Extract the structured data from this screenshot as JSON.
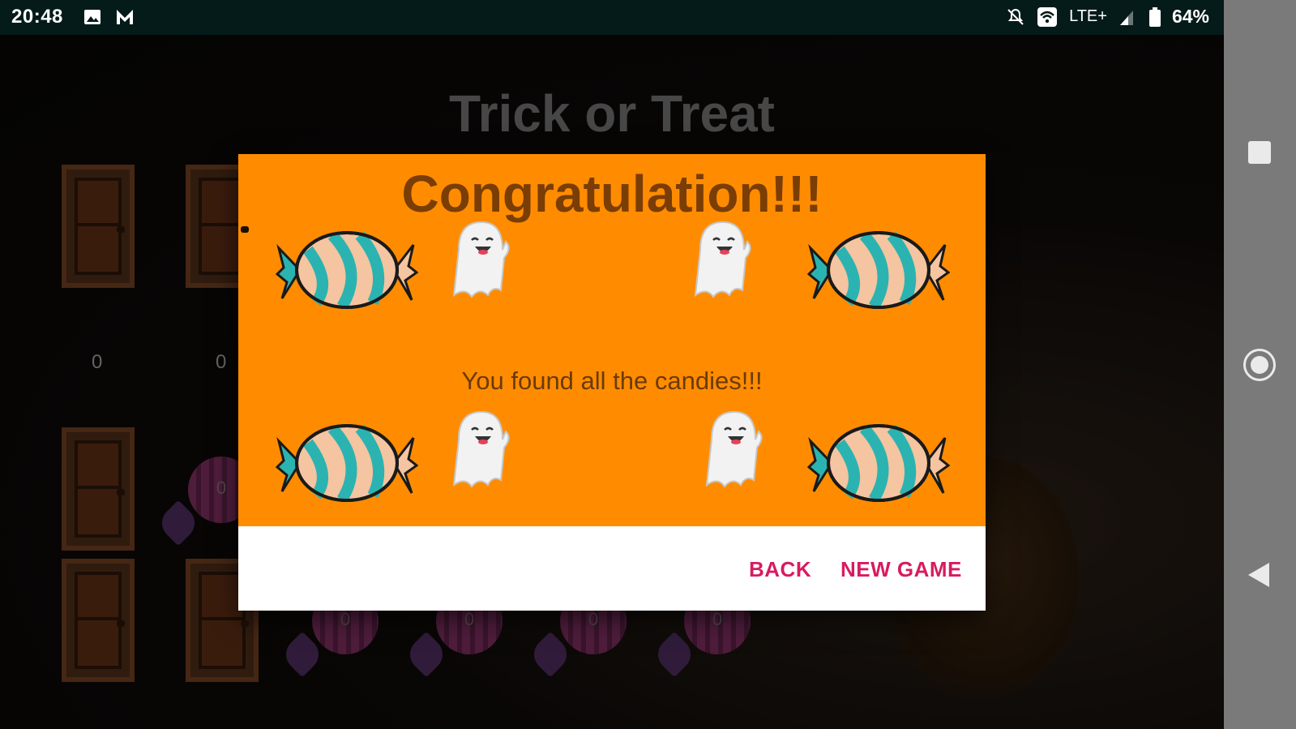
{
  "status_bar": {
    "time": "20:48",
    "left_icons": [
      "image-icon",
      "messenger-icon"
    ],
    "network": "LTE+",
    "battery": "64%",
    "right_icons": [
      "mute-icon",
      "wifi-icon",
      "signal-icon",
      "battery-icon"
    ]
  },
  "game": {
    "title": "Trick or Treat",
    "scores": [
      "0",
      "0"
    ],
    "candy_labels": [
      "0",
      "0",
      "0",
      "0",
      "0"
    ]
  },
  "dialog": {
    "title": "Congratulation!!!",
    "message": "You found all the candies!!!",
    "buttons": {
      "back": "BACK",
      "new_game": "NEW GAME"
    },
    "colors": {
      "background": "#ff8c00",
      "title": "#7a3d06",
      "button_text": "#d81b60"
    }
  },
  "nav_bar": {
    "icons": [
      "recents-icon",
      "home-icon",
      "back-icon"
    ]
  }
}
